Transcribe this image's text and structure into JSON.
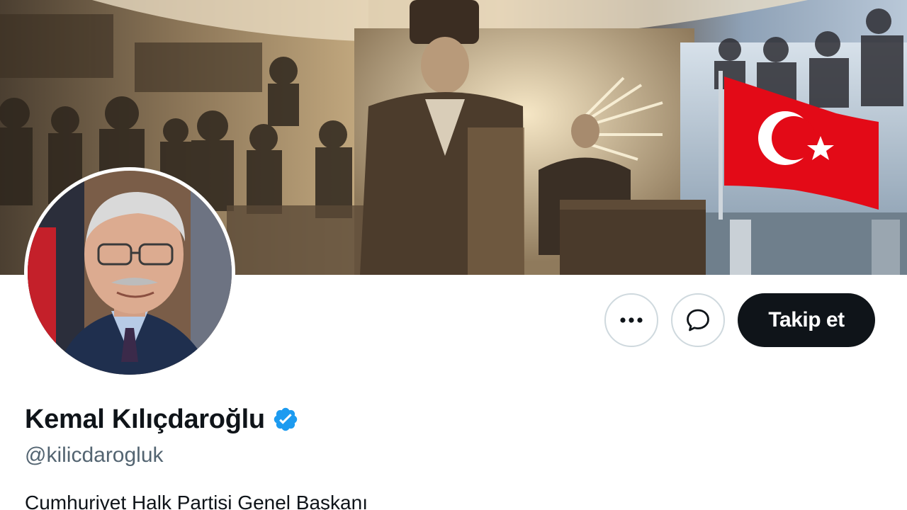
{
  "colors": {
    "follow_button_bg": "#0f1419",
    "follow_button_text": "#ffffff",
    "verified_badge": "#1d9bf0",
    "handle_text": "#536471",
    "flag_red": "#e30a17"
  },
  "header_image": {
    "icon": "profile-banner-image"
  },
  "profile": {
    "display_name": "Kemal Kılıçdaroğlu",
    "verified": true,
    "verified_icon": "verified-badge-icon",
    "handle": "@kilicdarogluk",
    "bio": "Cumhuriyet Halk Partisi Genel Başkanı"
  },
  "actions": {
    "more_icon": "more-options-icon",
    "message_icon": "message-bubble-icon",
    "follow_label": "Takip et"
  }
}
